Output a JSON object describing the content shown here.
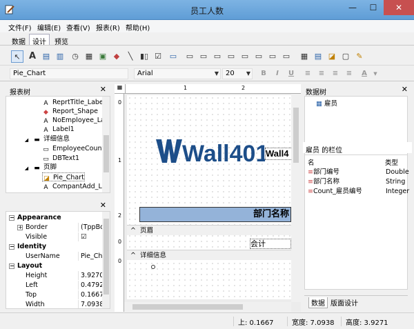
{
  "window": {
    "title": "员工人数",
    "min": "—",
    "max": "☐",
    "close": "✕"
  },
  "menu": [
    "文件(F)",
    "编辑(E)",
    "查看(V)",
    "报表(R)",
    "帮助(H)"
  ],
  "view_tabs": [
    "数据",
    "设计",
    "预览"
  ],
  "format": {
    "component": "Pie_Chart",
    "font": "Arial",
    "size": "20"
  },
  "report_tree": {
    "title": "报表树",
    "items": [
      {
        "label": "ReprtTitle_Label",
        "icon": "label-icon"
      },
      {
        "label": "Report_Shape",
        "icon": "shape-icon"
      },
      {
        "label": "NoEmployee_Lab",
        "icon": "label-icon"
      },
      {
        "label": "Label1",
        "icon": "label-icon"
      },
      {
        "label": "详细信息",
        "icon": "band-icon"
      },
      {
        "label": "EmployeeCount_",
        "icon": "text-icon"
      },
      {
        "label": "DBText1",
        "icon": "text-icon"
      },
      {
        "label": "页脚",
        "icon": "band-icon"
      },
      {
        "label": "Pie_Chart",
        "icon": "chart-icon"
      },
      {
        "label": "CompantAdd_La",
        "icon": "label-icon"
      }
    ]
  },
  "properties": {
    "rows": [
      {
        "cat": "Appearance"
      },
      {
        "k": "Border",
        "v": "(TppBor",
        "expand": true
      },
      {
        "k": "Visible",
        "v": "☑"
      },
      {
        "cat": "Identity"
      },
      {
        "k": "UserName",
        "v": "Pie_Char"
      },
      {
        "cat": "Layout"
      },
      {
        "k": "Height",
        "v": "3.92709"
      },
      {
        "k": "Left",
        "v": "0.47920"
      },
      {
        "k": "Top",
        "v": "0.16670"
      },
      {
        "k": "Width",
        "v": "7.09380"
      }
    ]
  },
  "canvas": {
    "logo_text": "Wall401K",
    "label_preview": "Wall4",
    "dept_header": "部门名称",
    "band_page_header": "页眉",
    "accounting": "会计",
    "band_detail": "详细信息",
    "ruler_marks": [
      "1",
      "2"
    ],
    "vruler_marks": [
      "0",
      "1",
      "2",
      "0",
      "0"
    ]
  },
  "data_tree": {
    "title": "数据树",
    "root": "雇员"
  },
  "fields": {
    "title": "雇员 的栏位",
    "col_name": "名",
    "col_type": "类型",
    "rows": [
      {
        "name": "部门编号",
        "type": "Double"
      },
      {
        "name": "部门名称",
        "type": "String"
      },
      {
        "name": "Count_雇员编号",
        "type": "Integer"
      }
    ]
  },
  "bottom_tabs": [
    "数据",
    "版面设计"
  ],
  "status": {
    "top": "上: 0.1667",
    "width": "宽度: 7.0938",
    "height": "高度: 3.9271"
  },
  "colors": {
    "dept_bar": "#94b3d9",
    "logo_dark": "#1d4e89",
    "logo_green": "#7cbf2a"
  }
}
